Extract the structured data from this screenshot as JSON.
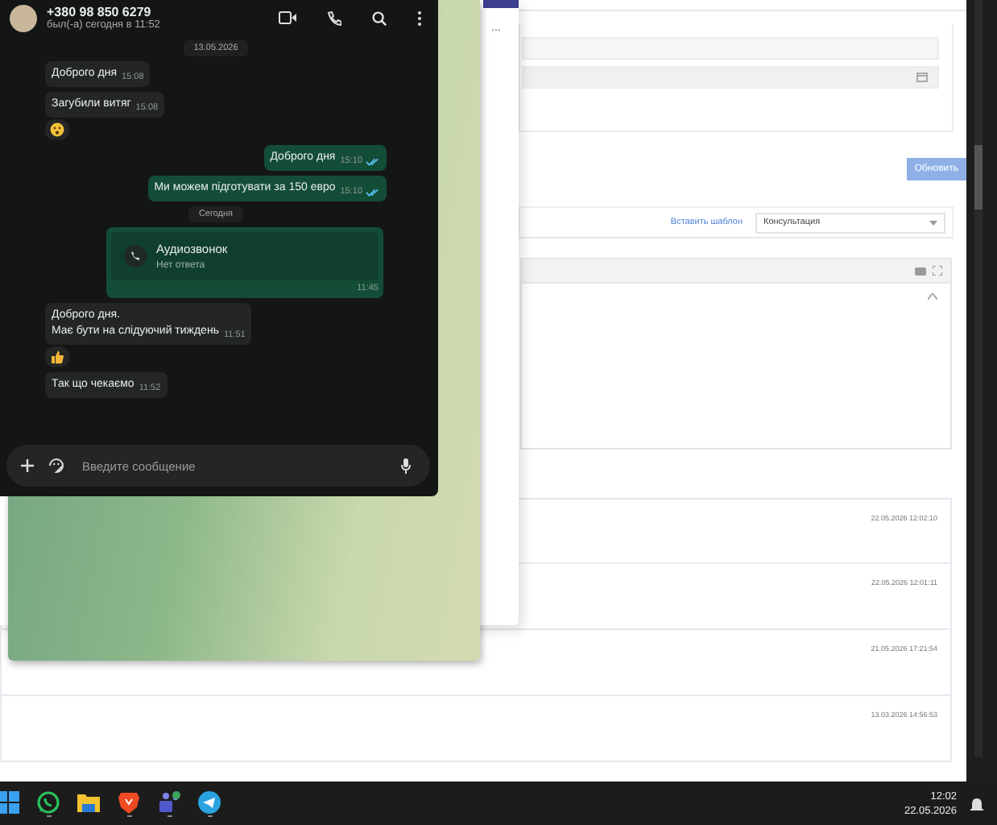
{
  "crm": {
    "more_label": "...",
    "update_button": "Обновить",
    "insert_template_link": "Вставить шаблон",
    "template_select": "Консультация",
    "history": [
      {
        "time": "22.05.2026 12:02:10"
      },
      {
        "time": "22.05.2026 12:01:11"
      },
      {
        "time": "21.05.2026 17:21:54"
      },
      {
        "time": "13.03.2026 14:56:53"
      }
    ]
  },
  "chat": {
    "contact": {
      "name": "+380 98 850 6279",
      "status": "был(-а) сегодня в 11:52"
    },
    "messages": [
      {
        "kind": "date",
        "text": "13.05.2026"
      },
      {
        "kind": "in",
        "text": "Доброго дня",
        "time": "15:08"
      },
      {
        "kind": "in",
        "text": "Загубили витяг",
        "time": "15:08",
        "reaction": {
          "kind": "wow"
        }
      },
      {
        "kind": "out",
        "text": "Доброго дня",
        "time": "15:10",
        "read": true
      },
      {
        "kind": "out",
        "text": "Ми можем підготувати за 150 евро",
        "time": "15:10",
        "read": true
      },
      {
        "kind": "date",
        "text": "Сегодня"
      },
      {
        "kind": "call",
        "title": "Аудиозвонок",
        "subtitle": "Нет ответа",
        "time": "11:45"
      },
      {
        "kind": "in",
        "text": "Доброго дня.\nМає бути на слідуючий тиждень",
        "time": "11:51",
        "reaction": {
          "kind": "like"
        }
      },
      {
        "kind": "in",
        "text": "Так що чекаємо",
        "time": "11:52"
      }
    ],
    "composer": {
      "placeholder": "Введите сообщение"
    }
  },
  "taskbar": {
    "apps": [
      {
        "kind": "start",
        "running": false
      },
      {
        "kind": "whatsapp",
        "running": true
      },
      {
        "kind": "files",
        "running": false
      },
      {
        "kind": "browser",
        "running": true
      },
      {
        "kind": "teams",
        "running": true
      },
      {
        "kind": "telegram",
        "running": true
      }
    ],
    "time": "12:02",
    "date": "22.05.2026"
  }
}
